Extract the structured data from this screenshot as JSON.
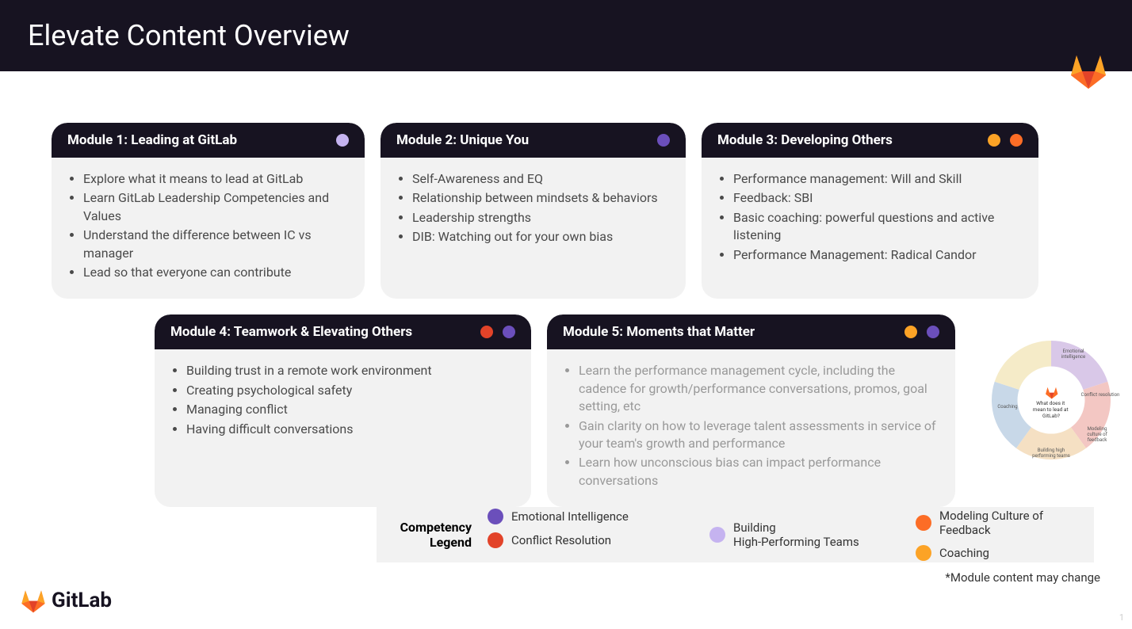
{
  "header": {
    "title": "Elevate Content Overview"
  },
  "colors": {
    "emotional_intelligence": "#6b4fbb",
    "conflict_resolution": "#e24329",
    "building_teams": "#c5b3f0",
    "modeling_feedback": "#fc6d26",
    "coaching": "#fca326"
  },
  "modules": {
    "m1": {
      "title": "Module 1: Leading at GitLab",
      "items": [
        "Explore what it means to lead at GitLab",
        "Learn GitLab Leadership Competencies and Values",
        "Understand the difference between IC vs manager",
        "Lead so that everyone can contribute"
      ]
    },
    "m2": {
      "title": "Module 2: Unique You",
      "items": [
        "Self-Awareness and EQ",
        "Relationship between mindsets & behaviors",
        "Leadership strengths",
        "DIB: Watching out for your own bias"
      ]
    },
    "m3": {
      "title": "Module 3: Developing Others",
      "items": [
        "Performance management: Will and Skill",
        "Feedback: SBI",
        "Basic coaching: powerful questions and active listening",
        "Performance Management: Radical Candor"
      ]
    },
    "m4": {
      "title": "Module 4: Teamwork & Elevating Others",
      "items": [
        "Building trust in a remote work environment",
        "Creating psychological safety",
        "Managing conflict",
        "Having difficult conversations"
      ]
    },
    "m5": {
      "title": "Module 5: Moments that Matter",
      "items": [
        "Learn the performance management cycle, including the cadence for growth/performance conversations, promos, goal setting, etc",
        "Gain clarity on how to leverage talent assessments in service of your team's growth and performance",
        "Learn how unconscious bias can impact performance conversations"
      ]
    }
  },
  "legend": {
    "title": "Competency Legend",
    "items": {
      "emotional": "Emotional Intelligence",
      "conflict": "Conflict Resolution",
      "building": "Building High-Performing Teams",
      "modeling": "Modeling Culture of Feedback",
      "coaching": "Coaching"
    }
  },
  "wheel": {
    "center": "What does it mean to lead at GitLab?",
    "segments": {
      "emotional": "Emotional intelligence",
      "conflict": "Conflict resolution",
      "modeling": "Modeling culture of feedback",
      "building": "Building high performing teams",
      "coaching": "Coaching"
    }
  },
  "footnote": "*Module content may change",
  "footer": {
    "brand": "GitLab"
  },
  "page_number": "1"
}
